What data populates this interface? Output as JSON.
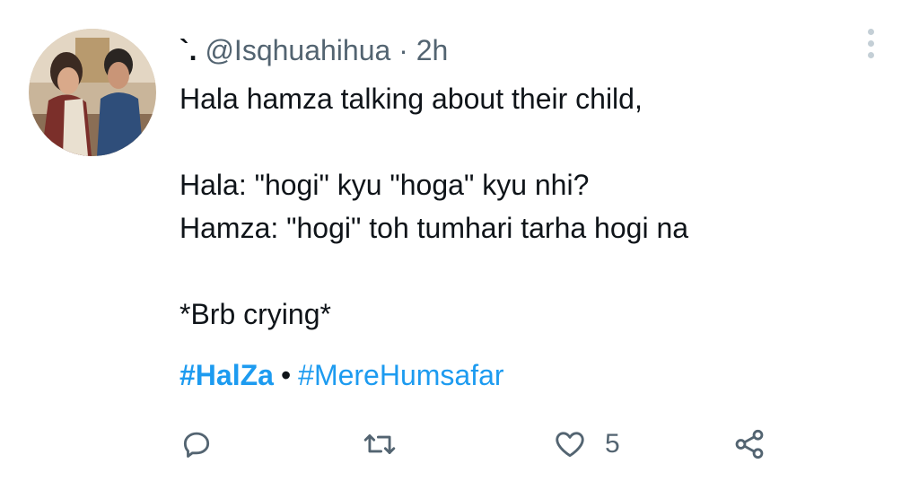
{
  "tweet": {
    "display_name": "`.",
    "handle": "@Isqhuahihua",
    "separator": "·",
    "time": "2h",
    "lines": [
      "Hala hamza talking about their child,",
      "",
      "Hala: \"hogi\" kyu \"hoga\" kyu nhi?",
      "Hamza: \"hogi\" toh tumhari tarha hogi na",
      "",
      "*Brb crying*"
    ],
    "hashtags": [
      "#HalZa",
      "#MereHumsafar"
    ],
    "hashtag_separator": "•"
  },
  "actions": {
    "reply_icon": "reply-icon",
    "retweet_icon": "retweet-icon",
    "like_icon": "heart-icon",
    "like_count": "5",
    "share_icon": "share-icon"
  },
  "colors": {
    "link": "#1d9bf0",
    "text": "#0f1419",
    "muted": "#536471"
  }
}
